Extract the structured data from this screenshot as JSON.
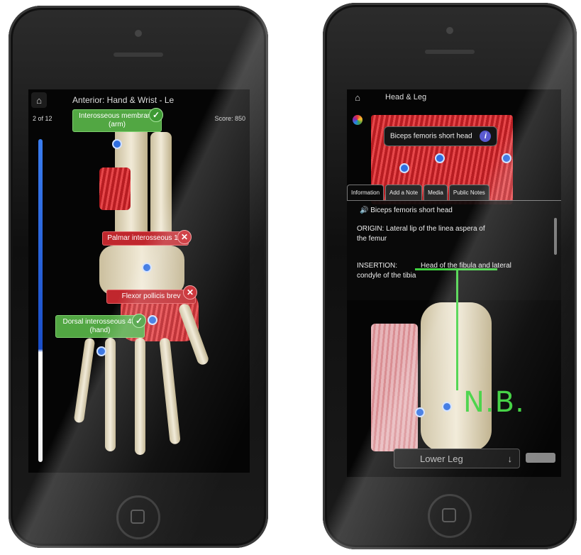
{
  "left_phone": {
    "nav_title": "Anterior: Hand & Wrist - Le",
    "page_count": "2 of 12",
    "score": "Score: 850",
    "labels": [
      {
        "text": "Interosseous membrane (arm)",
        "status": "correct"
      },
      {
        "text": "Palmar interosseous 1st",
        "status": "wrong"
      },
      {
        "text": "Flexor pollicis brev",
        "status": "wrong"
      },
      {
        "text": "Dorsal interosseous 4th (hand)",
        "status": "correct"
      }
    ],
    "icons": {
      "home": "home-icon",
      "correct": "checkmark-icon",
      "wrong": "close-icon"
    }
  },
  "right_phone": {
    "nav_title": "Head & Leg",
    "tooltip": "Biceps femoris short head",
    "tabs": [
      "Information",
      "Add a Note",
      "Media",
      "Public Notes"
    ],
    "info": {
      "speaker_title": "Biceps femoris short head",
      "origin_line1": "ORIGIN:   Lateral lip of the linea aspera of",
      "origin_line2": "the femur",
      "insertion_label": "INSERTION:",
      "insertion_value_1": "Head of the fibula and lateral",
      "insertion_value_2": "condyle of the tibia"
    },
    "annotation": "N.B.",
    "footer_label": "Lower Leg",
    "footer_arrow": "↓",
    "icons": {
      "home": "home-icon",
      "info": "info-icon",
      "color_wheel": "color-wheel-icon",
      "speaker": "speaker-icon"
    }
  }
}
